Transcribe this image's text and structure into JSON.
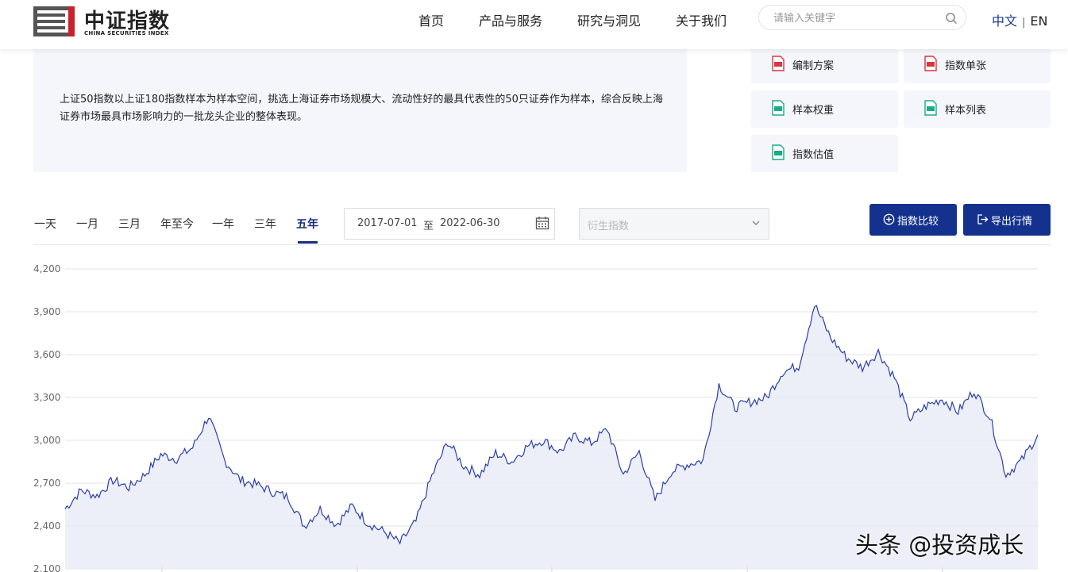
{
  "header": {
    "logo_cn": "中证指数",
    "logo_en": "CHINA SECURITIES INDEX",
    "nav": [
      "首页",
      "产品与服务",
      "研究与洞见",
      "关于我们"
    ],
    "search_placeholder": "请输入关键字",
    "lang_zh": "中文",
    "lang_sep": "|",
    "lang_en": "EN"
  },
  "description": "上证50指数以上证180指数样本为样本空间，挑选上海证券市场规模大、流动性好的最具代表性的50只证券作为样本，综合反映上海证券市场最具市场影响力的一批龙头企业的整体表现。",
  "documents": [
    {
      "label": "编制方案",
      "icon": "pdf-icon",
      "color": "#d9363e"
    },
    {
      "label": "指数单张",
      "icon": "pdf-icon",
      "color": "#d9363e"
    },
    {
      "label": "样本权重",
      "icon": "xls-icon",
      "color": "#1aab8a"
    },
    {
      "label": "样本列表",
      "icon": "xls-icon",
      "color": "#1aab8a"
    },
    {
      "label": "指数估值",
      "icon": "xls-icon",
      "color": "#1aab8a"
    }
  ],
  "range_tabs": [
    "一天",
    "一月",
    "三月",
    "年至今",
    "一年",
    "三年",
    "五年"
  ],
  "active_tab": "五年",
  "date_range": {
    "start": "2017-07-01",
    "to": "至",
    "end": "2022-06-30"
  },
  "derivative_select_placeholder": "衍生指数",
  "buttons": {
    "compare": "指数比较",
    "export": "导出行情"
  },
  "colors": {
    "brand": "#14318e",
    "line": "#2b3ea8",
    "fill": "#e6eaf5"
  },
  "chart_data": {
    "type": "area",
    "x": [
      "2017-07",
      "2017-08",
      "2017-09",
      "2017-10",
      "2017-11",
      "2017-12",
      "2018-01",
      "2018-02",
      "2018-03",
      "2018-04",
      "2018-05",
      "2018-06",
      "2018-07",
      "2018-08",
      "2018-09",
      "2018-10",
      "2018-11",
      "2018-12",
      "2019-01",
      "2019-02",
      "2019-03",
      "2019-04",
      "2019-05",
      "2019-06",
      "2019-07",
      "2019-08",
      "2019-09",
      "2019-10",
      "2019-11",
      "2019-12",
      "2020-01",
      "2020-02",
      "2020-03",
      "2020-04",
      "2020-05",
      "2020-06",
      "2020-07",
      "2020-08",
      "2020-09",
      "2020-10",
      "2020-11",
      "2020-12",
      "2021-01",
      "2021-02",
      "2021-03",
      "2021-04",
      "2021-05",
      "2021-06",
      "2021-07",
      "2021-08",
      "2021-09",
      "2021-10",
      "2021-11",
      "2021-12",
      "2022-01",
      "2022-02",
      "2022-03",
      "2022-04",
      "2022-05",
      "2022-06"
    ],
    "values": [
      2520,
      2650,
      2610,
      2720,
      2670,
      2760,
      2900,
      2870,
      2950,
      3170,
      2860,
      2720,
      2690,
      2640,
      2600,
      2400,
      2520,
      2410,
      2540,
      2420,
      2360,
      2280,
      2430,
      2750,
      2990,
      2820,
      2760,
      2910,
      2850,
      2960,
      3000,
      2920,
      3030,
      2980,
      3080,
      2760,
      2920,
      2580,
      2780,
      2830,
      2860,
      3390,
      3230,
      3270,
      3300,
      3480,
      3520,
      3950,
      3720,
      3580,
      3510,
      3620,
      3440,
      3150,
      3240,
      3290,
      3200,
      3350,
      3160,
      2760,
      2860,
      3040
    ],
    "ylim": [
      2100,
      4200
    ],
    "yticks": [
      "4,200",
      "3,900",
      "3,600",
      "3,300",
      "3,000",
      "2,700",
      "2,400",
      "2,100"
    ],
    "grid": true
  },
  "watermark": "头条 @投资成长"
}
